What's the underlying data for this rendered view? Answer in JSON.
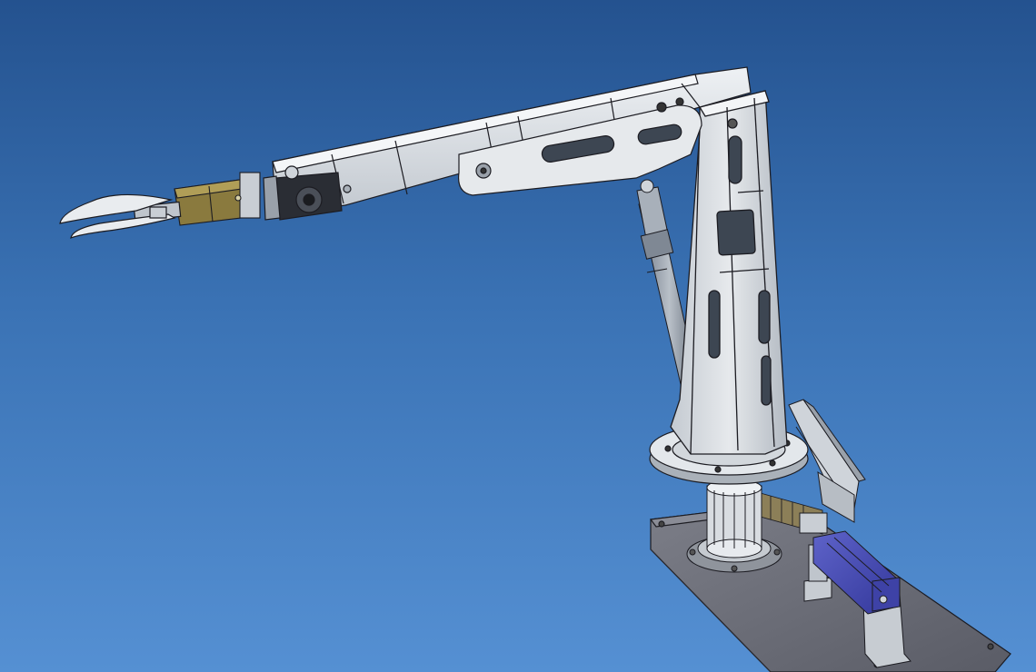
{
  "viewport": {
    "background_top": "#24528f",
    "background_bottom": "#5590d3"
  },
  "model": {
    "parts": [
      "base-plate",
      "rotary-bearing",
      "gear-rack",
      "servo-motor",
      "motor-bracket",
      "linear-guide",
      "turntable",
      "tower-column",
      "hydraulic-cylinder",
      "upper-arm",
      "wrist-motor",
      "gripper-actuator",
      "gripper-jaws"
    ],
    "colors": {
      "steel": "#d9dee3",
      "base": "#6d6f79",
      "servo": "#4b4fb5",
      "actuator": "#8a7a3e",
      "outline": "#1c1c22"
    }
  }
}
